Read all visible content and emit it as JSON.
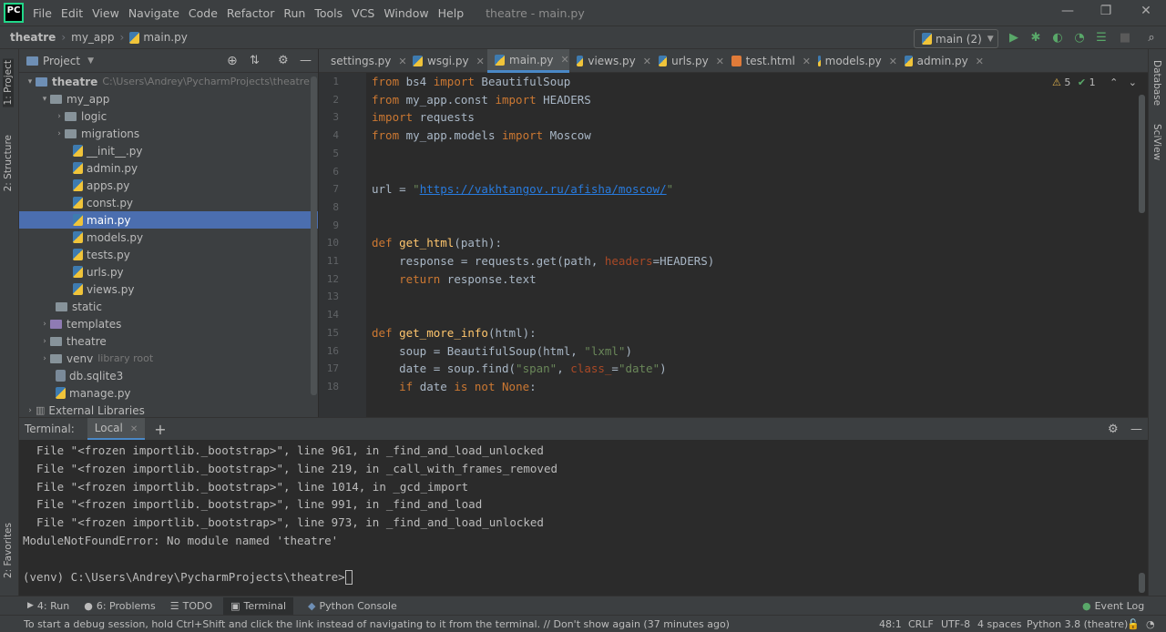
{
  "menubar": {
    "logo": "PC",
    "items": [
      "File",
      "Edit",
      "View",
      "Navigate",
      "Code",
      "Refactor",
      "Run",
      "Tools",
      "VCS",
      "Window",
      "Help"
    ],
    "window_title": "theatre - main.py"
  },
  "navbar": {
    "crumbs": [
      "theatre",
      "my_app",
      "main.py"
    ],
    "run_config": "main (2)"
  },
  "left_strip": {
    "tabs": [
      "1: Project",
      "2: Structure",
      "2: Favorites"
    ]
  },
  "right_strip": {
    "tabs": [
      "Database",
      "SciView"
    ]
  },
  "project": {
    "title": "Project",
    "rows": [
      {
        "label": "theatre",
        "hint": "C:\\Users\\Andrey\\PycharmProjects\\theatre"
      },
      {
        "label": "my_app",
        "hint": ""
      },
      {
        "label": "logic",
        "hint": ""
      },
      {
        "label": "migrations",
        "hint": ""
      },
      {
        "label": "__init__.py",
        "hint": ""
      },
      {
        "label": "admin.py",
        "hint": ""
      },
      {
        "label": "apps.py",
        "hint": ""
      },
      {
        "label": "const.py",
        "hint": ""
      },
      {
        "label": "main.py",
        "hint": ""
      },
      {
        "label": "models.py",
        "hint": ""
      },
      {
        "label": "tests.py",
        "hint": ""
      },
      {
        "label": "urls.py",
        "hint": ""
      },
      {
        "label": "views.py",
        "hint": ""
      },
      {
        "label": "static",
        "hint": ""
      },
      {
        "label": "templates",
        "hint": ""
      },
      {
        "label": "theatre",
        "hint": ""
      },
      {
        "label": "venv",
        "hint": "library root"
      },
      {
        "label": "db.sqlite3",
        "hint": ""
      },
      {
        "label": "manage.py",
        "hint": ""
      },
      {
        "label": "External Libraries",
        "hint": ""
      }
    ]
  },
  "editor": {
    "tabs": [
      "settings.py",
      "wsgi.py",
      "main.py",
      "views.py",
      "urls.py",
      "test.html",
      "models.py",
      "admin.py"
    ],
    "warnings": "5",
    "ok": "1",
    "line_numbers": [
      "1",
      "2",
      "3",
      "4",
      "5",
      "6",
      "7",
      "8",
      "9",
      "10",
      "11",
      "12",
      "13",
      "14",
      "15",
      "16",
      "17",
      "18"
    ]
  },
  "terminal": {
    "label": "Terminal:",
    "tab": "Local",
    "lines": [
      "  File \"<frozen importlib._bootstrap>\", line 961, in _find_and_load_unlocked",
      "  File \"<frozen importlib._bootstrap>\", line 219, in _call_with_frames_removed",
      "  File \"<frozen importlib._bootstrap>\", line 1014, in _gcd_import",
      "  File \"<frozen importlib._bootstrap>\", line 991, in _find_and_load",
      "  File \"<frozen importlib._bootstrap>\", line 973, in _find_and_load_unlocked",
      "ModuleNotFoundError: No module named 'theatre'",
      "",
      "(venv) C:\\Users\\Andrey\\PycharmProjects\\theatre>"
    ]
  },
  "bottombar": {
    "tabs": [
      "4: Run",
      "6: Problems",
      "TODO",
      "Terminal",
      "Python Console"
    ],
    "event_log": "Event Log"
  },
  "statusbar": {
    "message": "To start a debug session, hold Ctrl+Shift and click the link instead of navigating to it from the terminal. // Don't show again (37 minutes ago)",
    "position": "48:1",
    "line_sep": "CRLF",
    "encoding": "UTF-8",
    "indent": "4 spaces",
    "interpreter": "Python 3.8 (theatre)"
  }
}
